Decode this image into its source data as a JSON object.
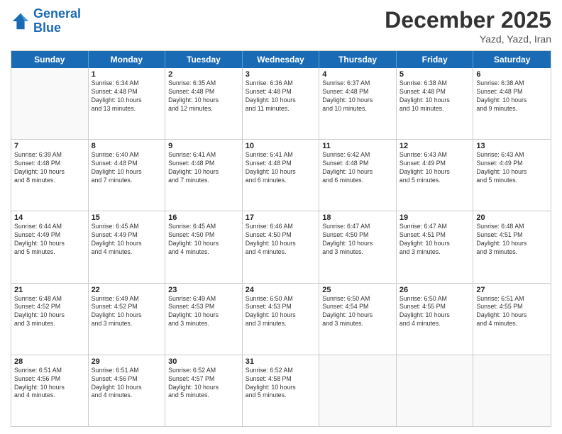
{
  "header": {
    "logo_line1": "General",
    "logo_line2": "Blue",
    "month": "December 2025",
    "location": "Yazd, Yazd, Iran"
  },
  "days_of_week": [
    "Sunday",
    "Monday",
    "Tuesday",
    "Wednesday",
    "Thursday",
    "Friday",
    "Saturday"
  ],
  "weeks": [
    [
      {
        "day": "",
        "info": ""
      },
      {
        "day": "1",
        "info": "Sunrise: 6:34 AM\nSunset: 4:48 PM\nDaylight: 10 hours\nand 13 minutes."
      },
      {
        "day": "2",
        "info": "Sunrise: 6:35 AM\nSunset: 4:48 PM\nDaylight: 10 hours\nand 12 minutes."
      },
      {
        "day": "3",
        "info": "Sunrise: 6:36 AM\nSunset: 4:48 PM\nDaylight: 10 hours\nand 11 minutes."
      },
      {
        "day": "4",
        "info": "Sunrise: 6:37 AM\nSunset: 4:48 PM\nDaylight: 10 hours\nand 10 minutes."
      },
      {
        "day": "5",
        "info": "Sunrise: 6:38 AM\nSunset: 4:48 PM\nDaylight: 10 hours\nand 10 minutes."
      },
      {
        "day": "6",
        "info": "Sunrise: 6:38 AM\nSunset: 4:48 PM\nDaylight: 10 hours\nand 9 minutes."
      }
    ],
    [
      {
        "day": "7",
        "info": "Sunrise: 6:39 AM\nSunset: 4:48 PM\nDaylight: 10 hours\nand 8 minutes."
      },
      {
        "day": "8",
        "info": "Sunrise: 6:40 AM\nSunset: 4:48 PM\nDaylight: 10 hours\nand 7 minutes."
      },
      {
        "day": "9",
        "info": "Sunrise: 6:41 AM\nSunset: 4:48 PM\nDaylight: 10 hours\nand 7 minutes."
      },
      {
        "day": "10",
        "info": "Sunrise: 6:41 AM\nSunset: 4:48 PM\nDaylight: 10 hours\nand 6 minutes."
      },
      {
        "day": "11",
        "info": "Sunrise: 6:42 AM\nSunset: 4:48 PM\nDaylight: 10 hours\nand 6 minutes."
      },
      {
        "day": "12",
        "info": "Sunrise: 6:43 AM\nSunset: 4:49 PM\nDaylight: 10 hours\nand 5 minutes."
      },
      {
        "day": "13",
        "info": "Sunrise: 6:43 AM\nSunset: 4:49 PM\nDaylight: 10 hours\nand 5 minutes."
      }
    ],
    [
      {
        "day": "14",
        "info": "Sunrise: 6:44 AM\nSunset: 4:49 PM\nDaylight: 10 hours\nand 5 minutes."
      },
      {
        "day": "15",
        "info": "Sunrise: 6:45 AM\nSunset: 4:49 PM\nDaylight: 10 hours\nand 4 minutes."
      },
      {
        "day": "16",
        "info": "Sunrise: 6:45 AM\nSunset: 4:50 PM\nDaylight: 10 hours\nand 4 minutes."
      },
      {
        "day": "17",
        "info": "Sunrise: 6:46 AM\nSunset: 4:50 PM\nDaylight: 10 hours\nand 4 minutes."
      },
      {
        "day": "18",
        "info": "Sunrise: 6:47 AM\nSunset: 4:50 PM\nDaylight: 10 hours\nand 3 minutes."
      },
      {
        "day": "19",
        "info": "Sunrise: 6:47 AM\nSunset: 4:51 PM\nDaylight: 10 hours\nand 3 minutes."
      },
      {
        "day": "20",
        "info": "Sunrise: 6:48 AM\nSunset: 4:51 PM\nDaylight: 10 hours\nand 3 minutes."
      }
    ],
    [
      {
        "day": "21",
        "info": "Sunrise: 6:48 AM\nSunset: 4:52 PM\nDaylight: 10 hours\nand 3 minutes."
      },
      {
        "day": "22",
        "info": "Sunrise: 6:49 AM\nSunset: 4:52 PM\nDaylight: 10 hours\nand 3 minutes."
      },
      {
        "day": "23",
        "info": "Sunrise: 6:49 AM\nSunset: 4:53 PM\nDaylight: 10 hours\nand 3 minutes."
      },
      {
        "day": "24",
        "info": "Sunrise: 6:50 AM\nSunset: 4:53 PM\nDaylight: 10 hours\nand 3 minutes."
      },
      {
        "day": "25",
        "info": "Sunrise: 6:50 AM\nSunset: 4:54 PM\nDaylight: 10 hours\nand 3 minutes."
      },
      {
        "day": "26",
        "info": "Sunrise: 6:50 AM\nSunset: 4:55 PM\nDaylight: 10 hours\nand 4 minutes."
      },
      {
        "day": "27",
        "info": "Sunrise: 6:51 AM\nSunset: 4:55 PM\nDaylight: 10 hours\nand 4 minutes."
      }
    ],
    [
      {
        "day": "28",
        "info": "Sunrise: 6:51 AM\nSunset: 4:56 PM\nDaylight: 10 hours\nand 4 minutes."
      },
      {
        "day": "29",
        "info": "Sunrise: 6:51 AM\nSunset: 4:56 PM\nDaylight: 10 hours\nand 4 minutes."
      },
      {
        "day": "30",
        "info": "Sunrise: 6:52 AM\nSunset: 4:57 PM\nDaylight: 10 hours\nand 5 minutes."
      },
      {
        "day": "31",
        "info": "Sunrise: 6:52 AM\nSunset: 4:58 PM\nDaylight: 10 hours\nand 5 minutes."
      },
      {
        "day": "",
        "info": ""
      },
      {
        "day": "",
        "info": ""
      },
      {
        "day": "",
        "info": ""
      }
    ]
  ]
}
